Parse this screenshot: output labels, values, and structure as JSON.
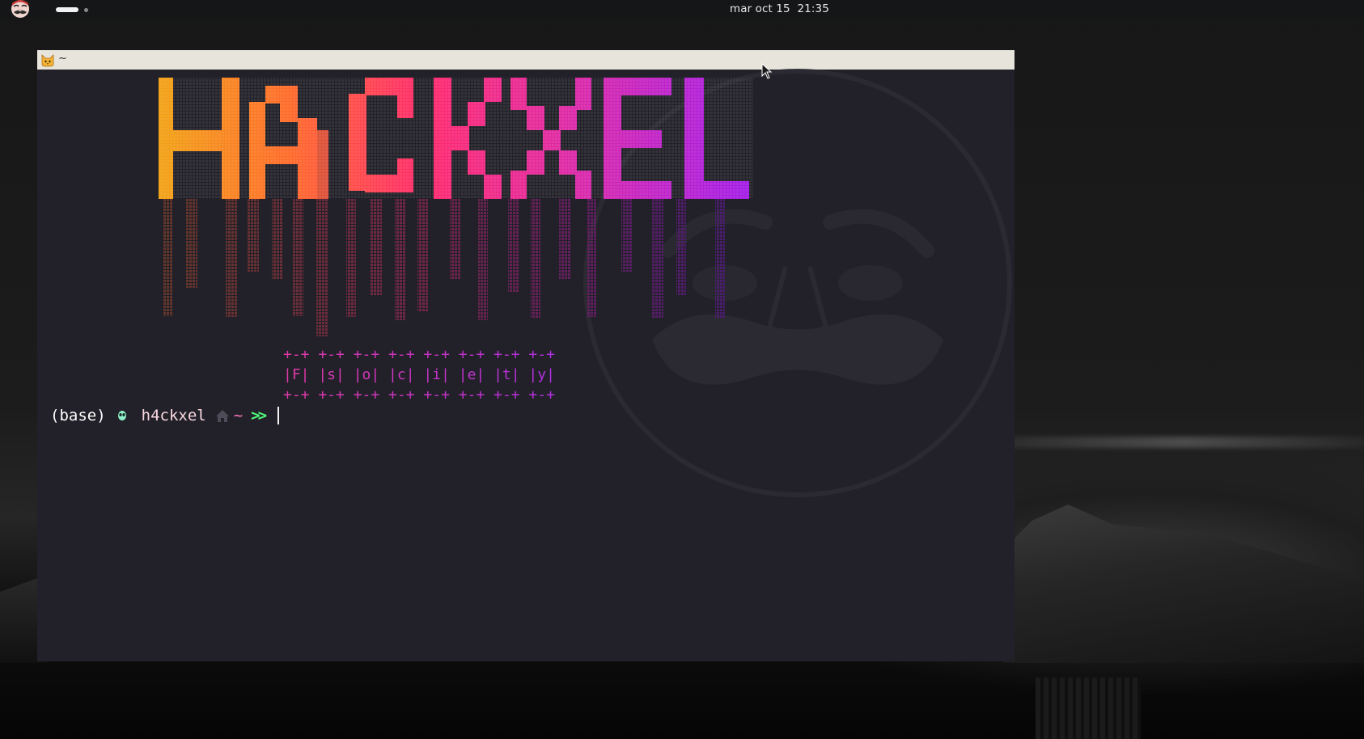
{
  "topbar": {
    "clock": "mar oct 15  21:35",
    "avatar_icon": "mr-robot-mask-icon",
    "workspace_indicator_active": "workspace-1",
    "workspace_count": 2
  },
  "terminal": {
    "title": "~",
    "app_icon": "cat-icon",
    "banner_text": "HACKXEL",
    "fsociety": {
      "top_border": "+-+ +-+ +-+ +-+ +-+ +-+ +-+ +-+",
      "letters_row": "|F| |s| |o| |c| |i| |e| |t| |y|",
      "bottom_border": "+-+ +-+ +-+ +-+ +-+ +-+ +-+ +-+"
    },
    "prompt": {
      "env": "(base)",
      "env_icon": "alien-icon",
      "user": "h4ckxel",
      "dir_icon": "home-icon",
      "dir": "~",
      "arrow": ">>"
    },
    "watermark_icon": "fsociety-mask-icon"
  },
  "colors": {
    "terminal_bg": "#222129",
    "titlebar_bg": "#e7e4dc",
    "banner_gradient": [
      "#f2a316",
      "#ff6b2a",
      "#ff2a6d",
      "#e02aa3",
      "#a31ee8"
    ],
    "fsociety_gradient": [
      "#e13aa8",
      "#b22fe2"
    ],
    "prompt_user": "#fad7e0",
    "prompt_dir": "#ff79c6",
    "prompt_arrow": "#50fa7b"
  }
}
